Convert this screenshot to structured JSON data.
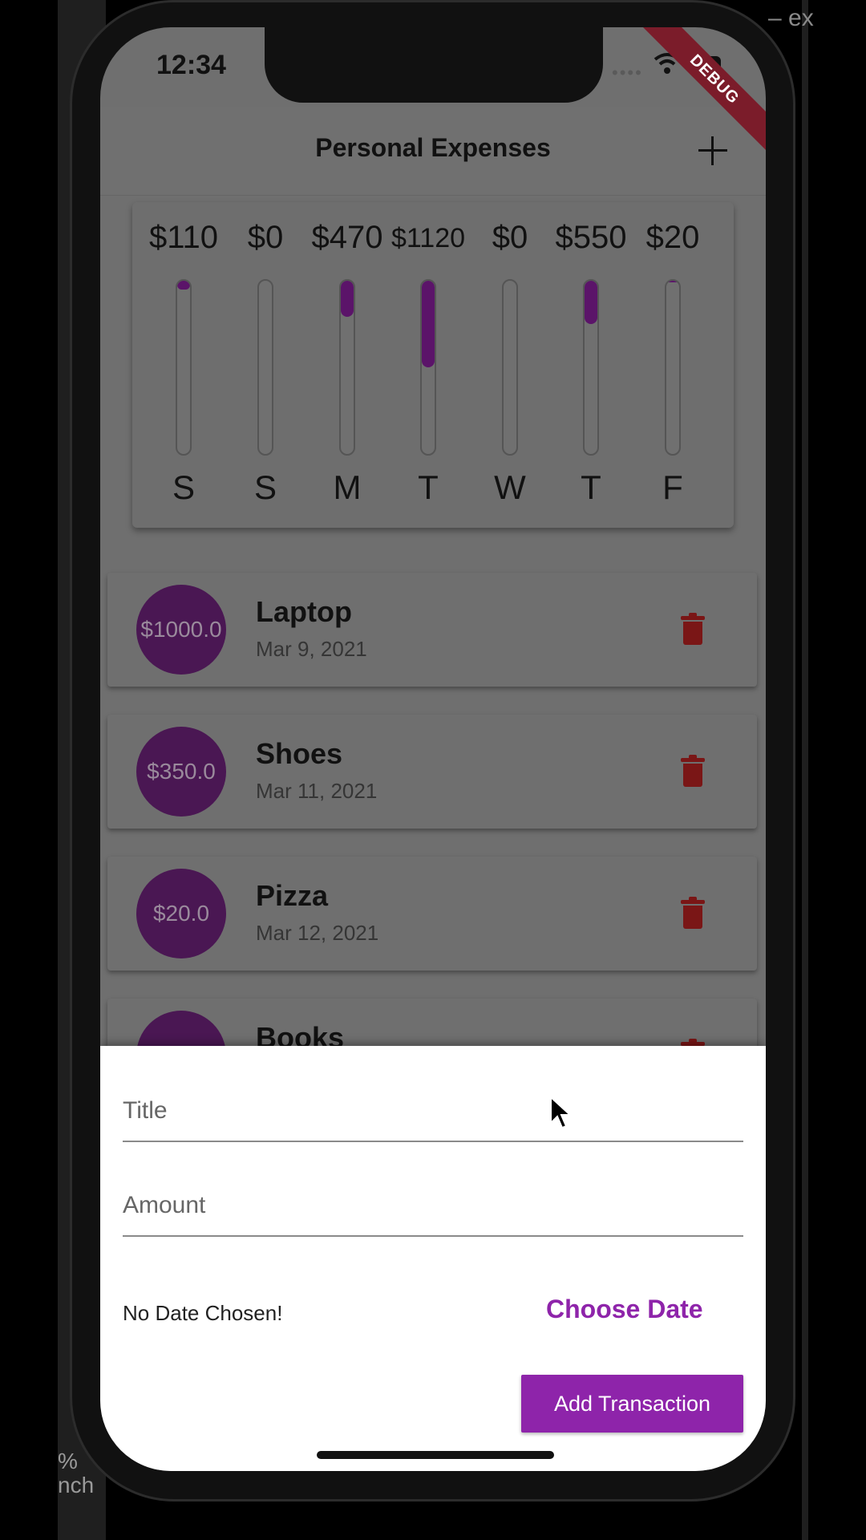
{
  "status_bar": {
    "time": "12:34",
    "debug_banner": "DEBUG"
  },
  "app_bar": {
    "title": "Personal Expenses",
    "add_icon": "plus-icon"
  },
  "chart_data": {
    "type": "bar",
    "categories": [
      "S",
      "S",
      "M",
      "T",
      "W",
      "T",
      "F"
    ],
    "values": [
      110,
      0,
      470,
      1120,
      0,
      550,
      20
    ],
    "value_labels": [
      "$110",
      "$0",
      "$470",
      "$1120",
      "$0",
      "$550",
      "$20"
    ],
    "fill_fraction": [
      0.05,
      0,
      0.21,
      0.5,
      0,
      0.25,
      0.01
    ],
    "colors": {
      "fill": "#5b1469",
      "track": "#707070"
    }
  },
  "transactions": [
    {
      "amount": "$1000.0",
      "title": "Laptop",
      "date": "Mar 9, 2021"
    },
    {
      "amount": "$350.0",
      "title": "Shoes",
      "date": "Mar 11, 2021"
    },
    {
      "amount": "$20.0",
      "title": "Pizza",
      "date": "Mar 12, 2021"
    },
    {
      "amount": "",
      "title": "Books",
      "date": ""
    }
  ],
  "form": {
    "title_placeholder": "Title",
    "amount_placeholder": "Amount",
    "date_status": "No Date Chosen!",
    "choose_date_label": "Choose Date",
    "submit_label": "Add Transaction"
  },
  "background": {
    "top_right": "– ex",
    "bottom_lines": [
      "%",
      "nch"
    ]
  },
  "colors": {
    "accent": "#8e24aa",
    "delete": "#7a1616",
    "avatar": "#4a1753"
  }
}
